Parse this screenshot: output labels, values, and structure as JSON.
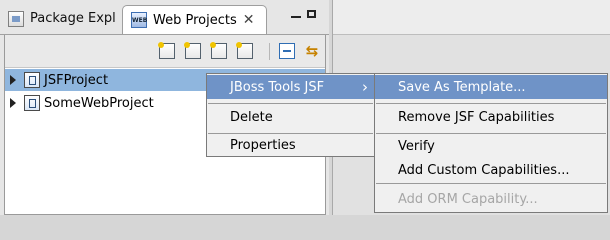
{
  "tabs": {
    "inactive_label": "Package Expl",
    "active_label": "Web Projects",
    "close_glyph": "✕"
  },
  "tree": {
    "items": [
      {
        "label": "JSFProject"
      },
      {
        "label": "SomeWebProject"
      }
    ]
  },
  "context_menu": {
    "jboss_label": "JBoss Tools JSF",
    "submenu_arrow": "›",
    "delete_label": "Delete",
    "properties_label": "Properties"
  },
  "submenu": {
    "save_as_template": "Save As Template...",
    "remove_jsf": "Remove JSF Capabilities",
    "verify": "Verify",
    "add_custom": "Add Custom Capabilities...",
    "add_orm": "Add ORM Capability..."
  },
  "icons": {
    "tabs": [
      "package-explorer-icon",
      "web-projects-icon"
    ],
    "toolbar": [
      "new-project-icon",
      "new-jsf-project-icon",
      "import-project-icon",
      "import-web-project-icon",
      "collapse-all-icon",
      "link-with-editor-icon"
    ]
  },
  "colors": {
    "selection": "#8fb6de",
    "menu_highlight": "#6f93c7"
  }
}
